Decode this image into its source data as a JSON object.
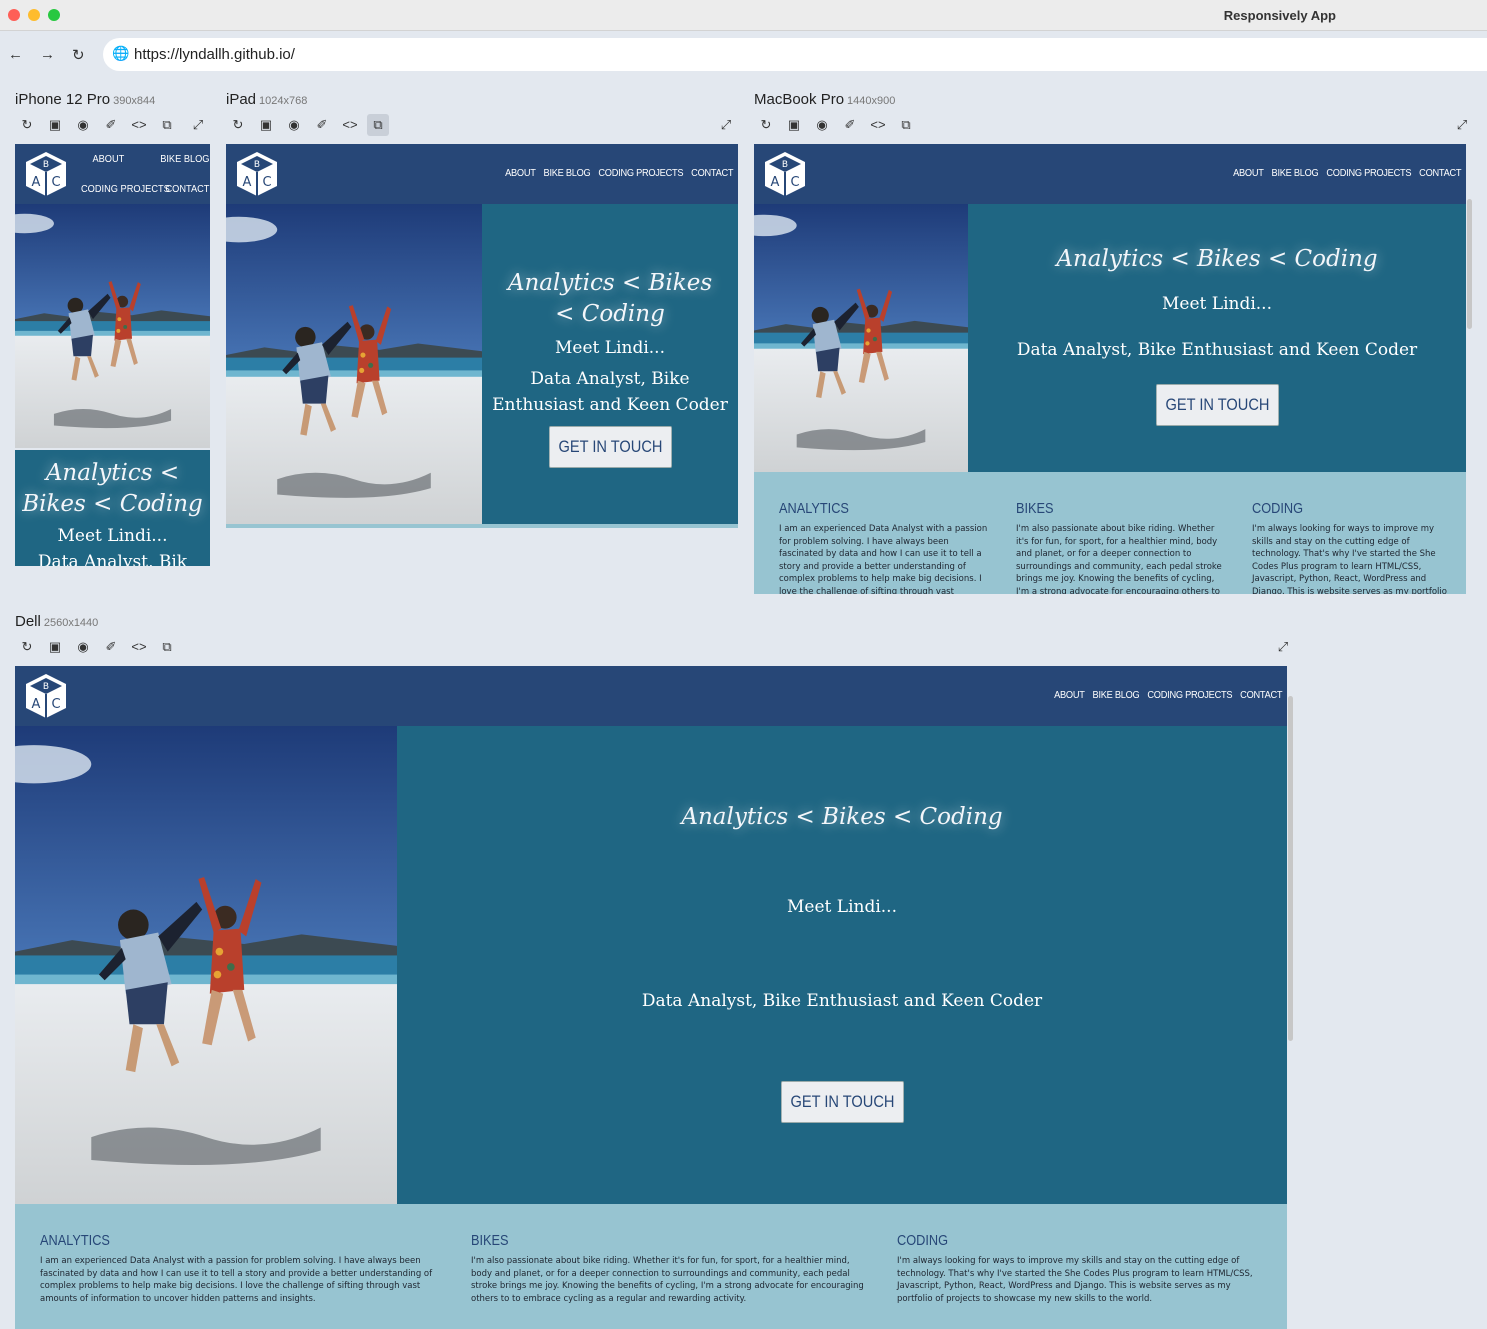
{
  "window": {
    "title": "Responsively App"
  },
  "address_bar": {
    "url": "https://lyndallh.github.io/"
  },
  "devices": [
    {
      "name": "iPhone 12 Pro",
      "res": "390x844"
    },
    {
      "name": "iPad",
      "res": "1024x768"
    },
    {
      "name": "MacBook Pro",
      "res": "1440x900"
    },
    {
      "name": "Dell",
      "res": "2560x1440"
    }
  ],
  "toolbar_icons": [
    "refresh-icon",
    "screenshot-full-icon",
    "camera-icon",
    "eyedropper-icon",
    "code-icon",
    "rotate-icon"
  ],
  "site": {
    "nav": [
      "ABOUT",
      "BIKE BLOG",
      "CODING PROJECTS",
      "CONTACT"
    ],
    "title": "Analytics < Bikes < Coding",
    "meet": "Meet Lindi...",
    "tagline": "Data Analyst, Bike Enthusiast and Keen Coder",
    "cta": "GET IN TOUCH",
    "columns": [
      {
        "heading": "ANALYTICS",
        "text": "I am an experienced Data Analyst with a passion for problem solving. I have always been fascinated by data and how I can use it to tell a story and provide a better understanding of complex problems to help make big decisions. I love the challenge of sifting through vast amounts of information to uncover hidden patterns and insights."
      },
      {
        "heading": "BIKES",
        "text": "I'm also passionate about bike riding. Whether it's for fun, for sport, for a healthier mind, body and planet, or for a deeper connection to surroundings and community, each pedal stroke brings me joy. Knowing the benefits of cycling, I'm a strong advocate for encouraging others to to embrace cycling as a regular and rewarding activity."
      },
      {
        "heading": "CODING",
        "text": "I'm always looking for ways to improve my skills and stay on the cutting edge of technology. That's why I've started the She Codes Plus program to learn HTML/CSS, Javascript, Python, React, WordPress and Django. This is website serves as my portfolio of projects to showcase my new skills to the world."
      }
    ],
    "iphone_tagline_fragment": "Data Analyst, Bik"
  },
  "colors": {
    "header": "#274777",
    "hero": "#1f6683",
    "band": "#97c4d1"
  }
}
